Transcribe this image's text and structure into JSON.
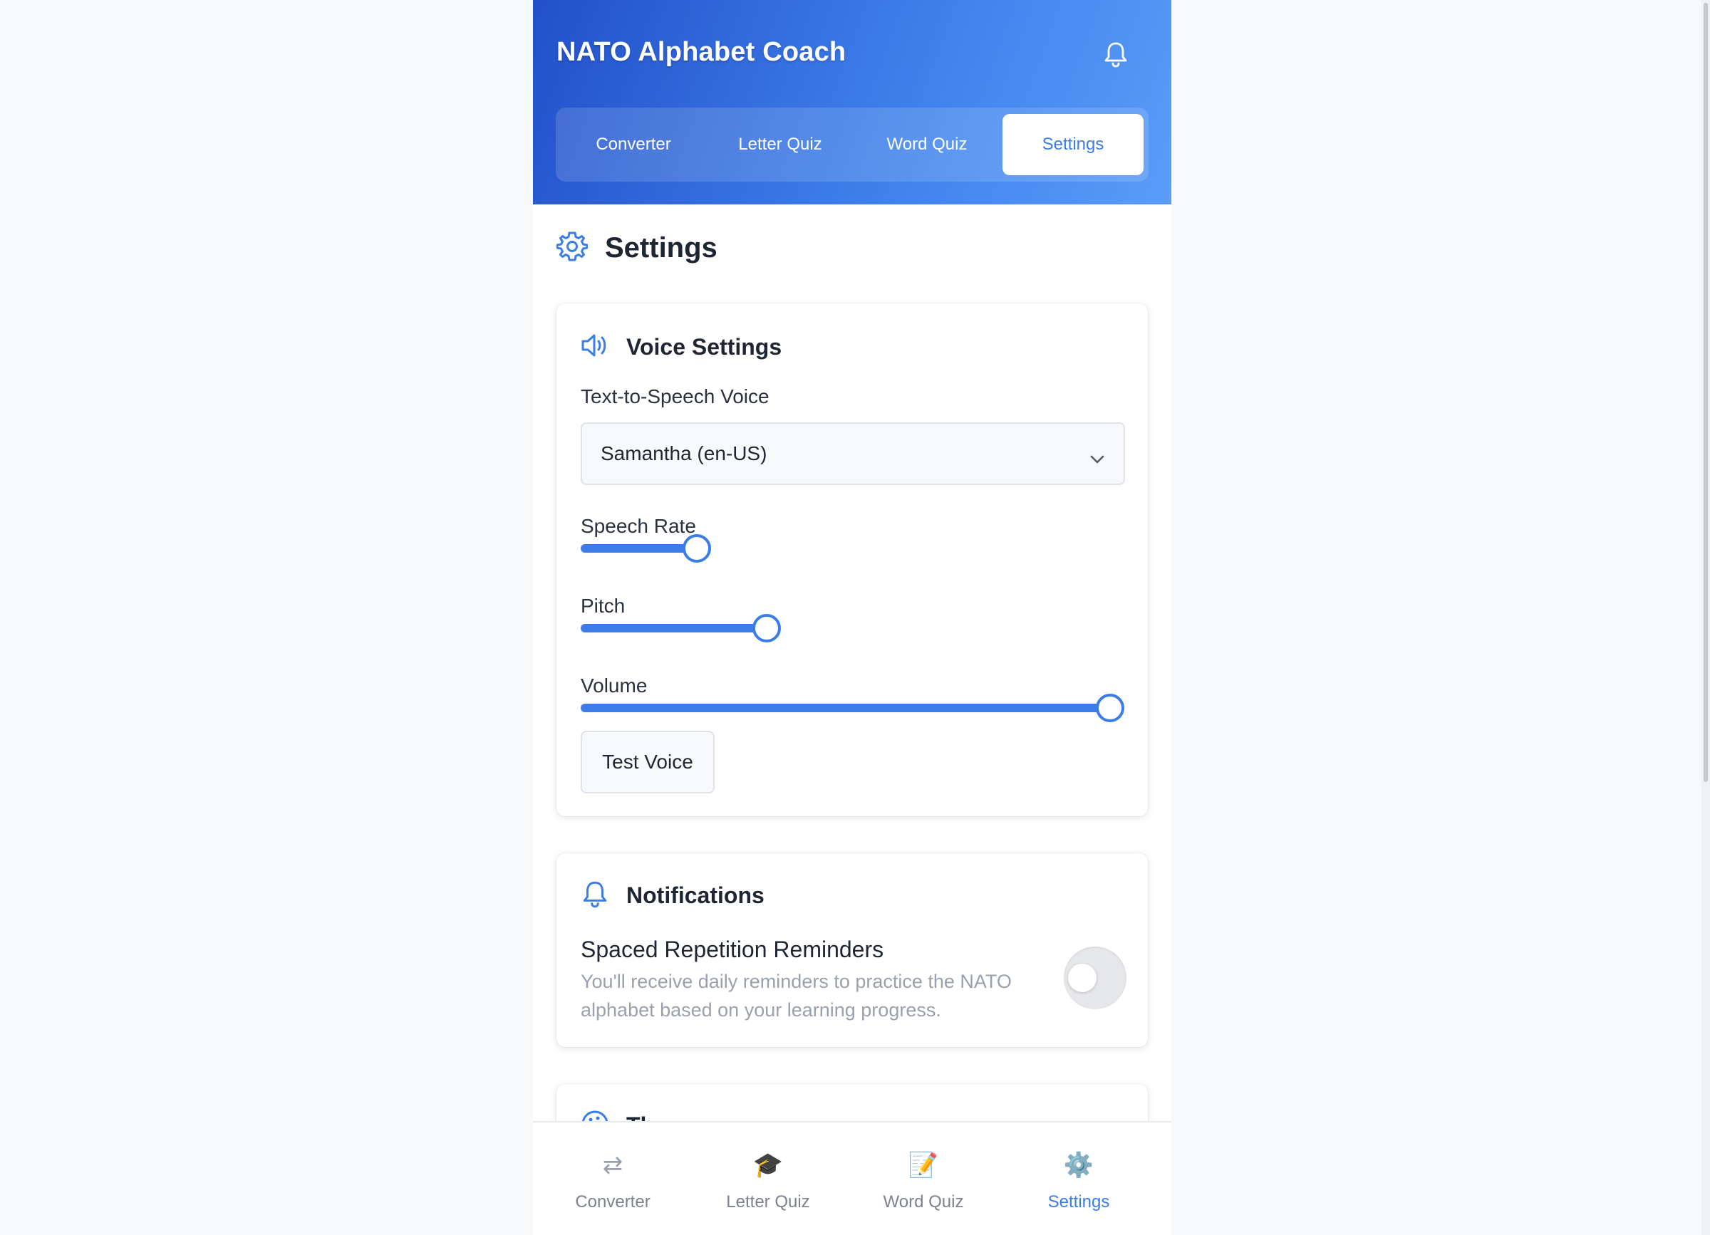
{
  "app": {
    "title": "NATO Alphabet Coach"
  },
  "tabs": [
    {
      "label": "Converter",
      "active": false
    },
    {
      "label": "Letter Quiz",
      "active": false
    },
    {
      "label": "Word Quiz",
      "active": false
    },
    {
      "label": "Settings",
      "active": true
    }
  ],
  "page": {
    "title": "Settings"
  },
  "voice_settings": {
    "title": "Voice Settings",
    "tts_label": "Text-to-Speech Voice",
    "selected_voice": "Samantha (en-US)",
    "sliders": [
      {
        "label": "Speech Rate",
        "value": 0.214
      },
      {
        "label": "Pitch",
        "value": 0.342
      },
      {
        "label": "Volume",
        "value": 0.973
      }
    ],
    "test_button": "Test Voice"
  },
  "notifications": {
    "title": "Notifications",
    "setting_title": "Spaced Repetition Reminders",
    "setting_desc": "You'll receive daily reminders to practice the NATO alphabet based on your learning progress.",
    "enabled": false
  },
  "theme_card": {
    "title": "Th"
  },
  "bottom_nav": [
    {
      "label": "Converter",
      "icon": "⇄",
      "icon_name": "swap-arrows-icon",
      "active": false
    },
    {
      "label": "Letter Quiz",
      "icon": "🎓",
      "icon_name": "graduation-cap-icon",
      "active": false
    },
    {
      "label": "Word Quiz",
      "icon": "📝",
      "icon_name": "memo-icon",
      "active": false
    },
    {
      "label": "Settings",
      "icon": "⚙️",
      "icon_name": "gear-icon",
      "active": true
    }
  ],
  "colors": {
    "accent": "#3b7de8",
    "header_start": "#2350c9",
    "header_end": "#5a9cf8"
  }
}
